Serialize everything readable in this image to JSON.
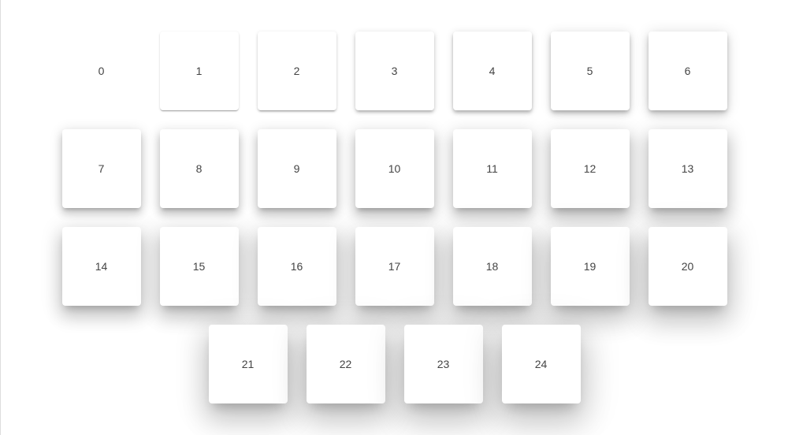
{
  "elevations": [
    "0",
    "1",
    "2",
    "3",
    "4",
    "5",
    "6",
    "7",
    "8",
    "9",
    "10",
    "11",
    "12",
    "13",
    "14",
    "15",
    "16",
    "17",
    "18",
    "19",
    "20",
    "21",
    "22",
    "23",
    "24"
  ]
}
